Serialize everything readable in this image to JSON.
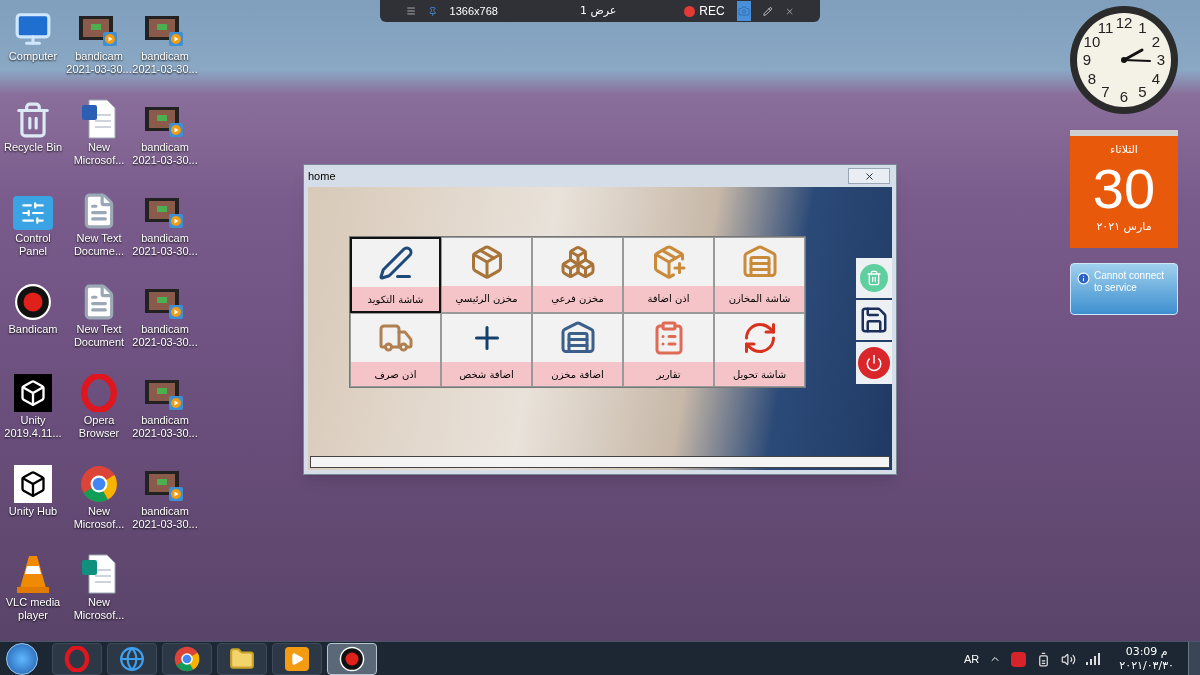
{
  "recorder_bar": {
    "resolution": "1366x768",
    "display": "عرض 1",
    "rec": "REC"
  },
  "desktop_icons": [
    {
      "label": "Computer",
      "kind": "computer"
    },
    {
      "label": "Recycle Bin",
      "kind": "recycle-bin"
    },
    {
      "label": "Control Panel",
      "kind": "control-panel"
    },
    {
      "label": "Bandicam",
      "kind": "bandicam"
    },
    {
      "label": "Unity 2019.4.11...",
      "kind": "unity"
    },
    {
      "label": "Unity Hub",
      "kind": "unity-hub"
    },
    {
      "label": "VLC media player",
      "kind": "vlc"
    },
    {
      "label": "bandicam 2021-03-30...",
      "kind": "video"
    },
    {
      "label": "New Microsof...",
      "kind": "word-doc"
    },
    {
      "label": "New Text Docume...",
      "kind": "text-doc"
    },
    {
      "label": "New Text Document",
      "kind": "text-doc"
    },
    {
      "label": "Opera Browser",
      "kind": "opera"
    },
    {
      "label": "New Microsof...",
      "kind": "chrome"
    },
    {
      "label": "New Microsof...",
      "kind": "publisher-doc"
    },
    {
      "label": "bandicam 2021-03-30...",
      "kind": "video"
    },
    {
      "label": "bandicam 2021-03-30...",
      "kind": "video"
    },
    {
      "label": "bandicam 2021-03-30...",
      "kind": "video"
    },
    {
      "label": "bandicam 2021-03-30...",
      "kind": "video"
    },
    {
      "label": "bandicam 2021-03-30...",
      "kind": "video"
    },
    {
      "label": "bandicam 2021-03-30...",
      "kind": "video"
    }
  ],
  "window": {
    "title": "home"
  },
  "tile_rows": [
    {
      "tiles": [
        {
          "label": "شاشة المخازن",
          "selected": false
        },
        {
          "label": "اذن اضافة",
          "selected": false
        },
        {
          "label": "مخزن فرعي",
          "selected": false
        },
        {
          "label": "مخزن الرئيسي",
          "selected": false
        },
        {
          "label": "شاشة التكويد",
          "selected": true
        }
      ]
    },
    {
      "tiles": [
        {
          "label": "شاشة تحويل",
          "selected": false
        },
        {
          "label": "تقارير",
          "selected": false
        },
        {
          "label": "اضافة مخزن",
          "selected": false
        },
        {
          "label": "اضافة شخص",
          "selected": false
        },
        {
          "label": "اذن صرف",
          "selected": false
        }
      ]
    }
  ],
  "clock": {
    "numerals": [
      "12",
      "11",
      "1",
      "10",
      "2",
      "9",
      "3",
      "8",
      "4",
      "7",
      "5",
      "6"
    ]
  },
  "calendar": {
    "weekday": "الثلاثاء",
    "day": "30",
    "month_year": "مارس ٢٠٢١"
  },
  "weather": {
    "message": "Cannot connect to service"
  },
  "taskbar": {
    "apps": [
      {
        "kind": "opera",
        "selected": false
      },
      {
        "kind": "ie",
        "selected": false
      },
      {
        "kind": "chrome",
        "selected": false
      },
      {
        "kind": "explorer",
        "selected": false
      },
      {
        "kind": "player",
        "selected": false
      },
      {
        "kind": "bandicam",
        "selected": true
      }
    ],
    "language": "AR",
    "time": "03:09 م",
    "date": "٢٠٢١/٠٣/٣٠"
  }
}
